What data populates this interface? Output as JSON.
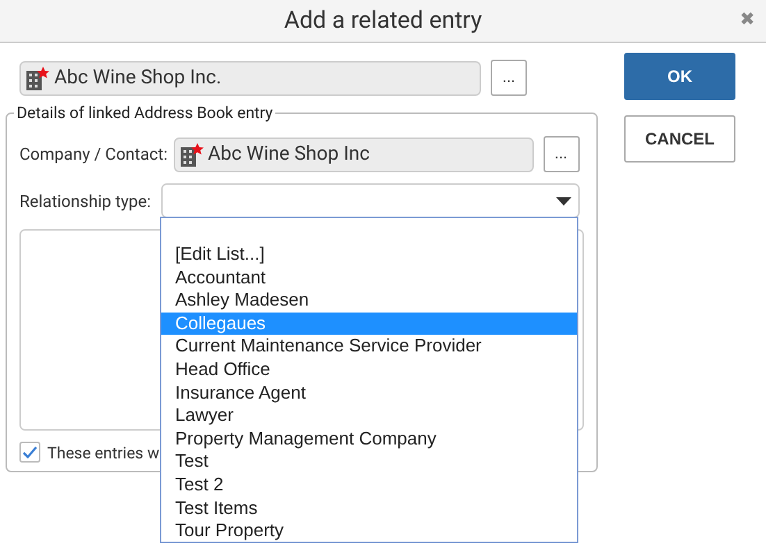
{
  "window": {
    "title": "Add a related entry",
    "close": "✖"
  },
  "entry": {
    "value": "Abc Wine Shop Inc.",
    "browse": "..."
  },
  "buttons": [
    {
      "label": "OK",
      "kind": "primary"
    },
    {
      "label": "CANCEL",
      "kind": "secondary"
    }
  ],
  "details": {
    "legend": "Details of linked Address Book entry",
    "company_label": "Company / Contact:",
    "company_value": "Abc Wine Shop Inc",
    "browse": "...",
    "relationship_label": "Relationship type:",
    "checkbox": {
      "label": "These entries w",
      "checked": true
    }
  },
  "dropdown": {
    "expanded": true,
    "options": [
      {
        "label": "[Edit List...]",
        "selected": false
      },
      {
        "label": "Accountant",
        "selected": false
      },
      {
        "label": "Ashley Madesen",
        "selected": false
      },
      {
        "label": "Collegaues",
        "selected": true
      },
      {
        "label": "Current Maintenance Service Provider",
        "selected": false
      },
      {
        "label": "Head Office",
        "selected": false
      },
      {
        "label": "Insurance Agent",
        "selected": false
      },
      {
        "label": "Lawyer",
        "selected": false
      },
      {
        "label": "Property Management Company",
        "selected": false
      },
      {
        "label": "Test",
        "selected": false
      },
      {
        "label": "Test 2",
        "selected": false
      },
      {
        "label": "Test Items",
        "selected": false
      },
      {
        "label": "Tour Property",
        "selected": false
      }
    ]
  }
}
